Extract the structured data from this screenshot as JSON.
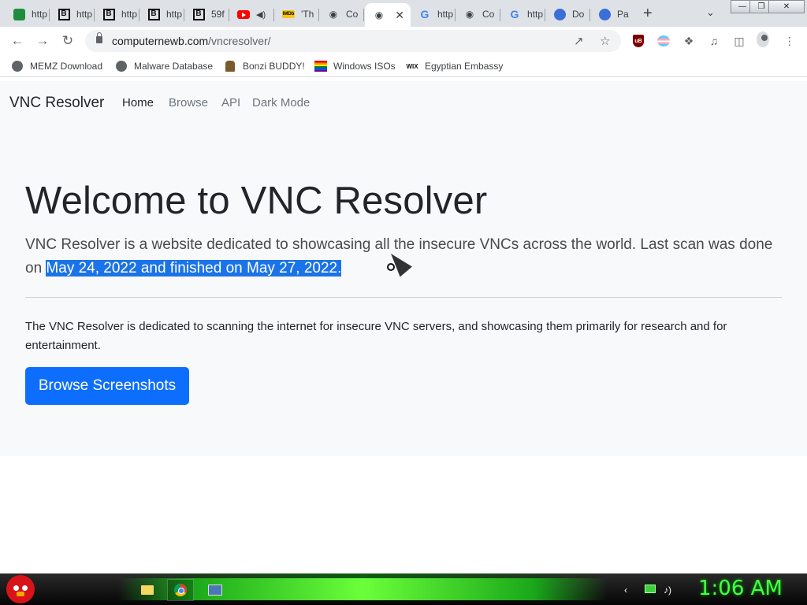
{
  "browser": {
    "tabs": [
      {
        "title": "http",
        "icon": "green-site-icon"
      },
      {
        "title": "http",
        "icon": "b-icon"
      },
      {
        "title": "http",
        "icon": "b-icon"
      },
      {
        "title": "http",
        "icon": "b-icon"
      },
      {
        "title": "59f",
        "icon": "b-icon"
      },
      {
        "title": "",
        "icon": "youtube-icon"
      },
      {
        "title": "'Th",
        "icon": "imdb-icon"
      },
      {
        "title": "Co",
        "icon": "github-icon"
      },
      {
        "title": "",
        "icon": "github-icon",
        "active": true
      },
      {
        "title": "http",
        "icon": "google-icon"
      },
      {
        "title": "Co",
        "icon": "github-icon"
      },
      {
        "title": "http",
        "icon": "google-icon"
      },
      {
        "title": "Do",
        "icon": "blue-site-icon"
      },
      {
        "title": "Pa",
        "icon": "blue-site-icon"
      }
    ],
    "url_host": "computernewb.com",
    "url_path": "/vncresolver/",
    "bookmarks": [
      {
        "label": "MEMZ Download"
      },
      {
        "label": "Malware Database"
      },
      {
        "label": "Bonzi BUDDY!"
      },
      {
        "label": "Windows ISOs"
      },
      {
        "label": "Egyptian Embassy"
      }
    ]
  },
  "page": {
    "brand": "VNC Resolver",
    "nav": [
      "Home",
      "Browse",
      "API",
      "Dark Mode"
    ],
    "hero_title": "Welcome to VNC Resolver",
    "lead_plain": "VNC Resolver is a website dedicated to showcasing all the insecure VNCs across the world. Last scan was done on",
    "lead_selected": "May 24, 2022 and finished on May 27, 2022.",
    "body_text": "The VNC Resolver is dedicated to scanning the internet for insecure VNC servers, and showcasing them primarily for research and for entertainment.",
    "cta": "Browse Screenshots"
  },
  "taskbar": {
    "clock": "1:06 AM"
  },
  "colors": {
    "primary": "#0d6efd",
    "selection": "#1a73e8",
    "page_bg": "#f8f9fa",
    "clock": "#45ff45"
  }
}
